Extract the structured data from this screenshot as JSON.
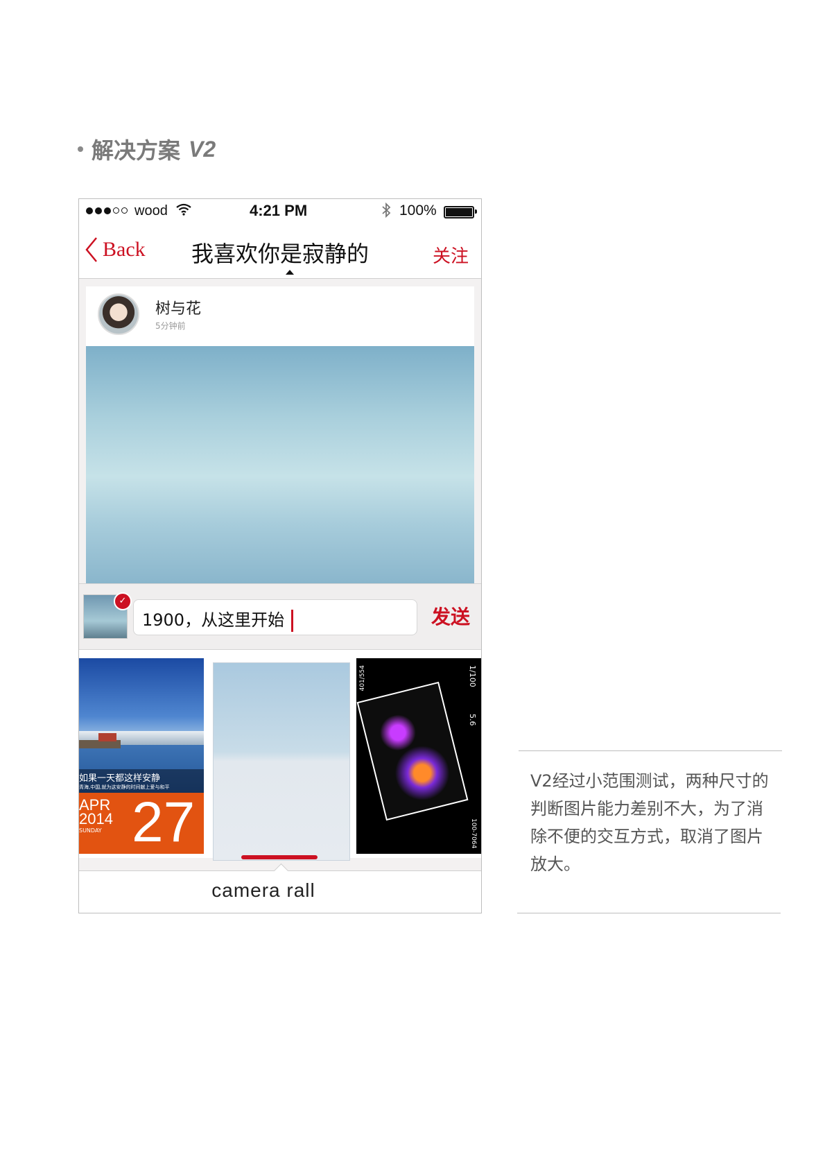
{
  "heading": {
    "text": "解决方案",
    "version": "V2"
  },
  "status_bar": {
    "carrier": "wood",
    "time": "4:21 PM",
    "battery": "100%"
  },
  "nav": {
    "back_label": "Back",
    "title": "我喜欢你是寂静的",
    "follow_label": "关注"
  },
  "post": {
    "username": "树与花",
    "timestamp": "5分钟前"
  },
  "composer": {
    "input_text": "1900，从这里开始",
    "send_label": "发送"
  },
  "camera_roll": {
    "label": "camera  rall",
    "photo1": {
      "caption_line1": "如果一天都这样安静",
      "caption_line2": "青海,中国,就为这安静的时间献上爱与和平",
      "month": "APR",
      "year": "2014",
      "weekday": "SUNDAY",
      "day": "27"
    },
    "photo3": {
      "shutter": "1/100",
      "aperture": "5.6",
      "frame": "100-7064",
      "counter": "401/554"
    }
  },
  "note": {
    "text": "V2经过小范围测试，两种尺寸的判断图片能力差别不大，为了消除不便的交互方式，取消了图片放大。"
  },
  "colors": {
    "accent": "#cc1122",
    "calendar_orange": "#e25311"
  }
}
